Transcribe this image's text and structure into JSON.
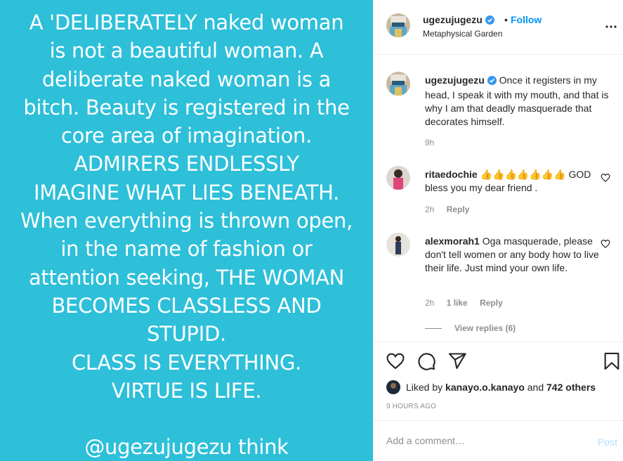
{
  "media": {
    "text": "A 'DELIBERATELY naked woman\nis not a beautiful woman. A\ndeliberate naked woman is a\nbitch. Beauty is registered in the\ncore area of imagination.\nADMIRERS ENDLESSLY\nIMAGINE WHAT LIES BENEATH.\nWhen everything is thrown open,\nin the name of fashion or\nattention seeking, THE WOMAN\nBECOMES CLASSLESS AND\nSTUPID.\nCLASS IS EVERYTHING.\nVIRTUE IS LIFE.\n\n@ugezujugezu think",
    "background_color": "#2ebfd9"
  },
  "header": {
    "username": "ugezujugezu",
    "separator": "•",
    "follow_label": "Follow",
    "location": "Metaphysical Garden",
    "more_icon": "more-horizontal-icon"
  },
  "caption": {
    "username": "ugezujugezu",
    "text": "Once it registers in my head, I speak it with my mouth, and that is why I am that deadly masquerade that decorates himself.",
    "time": "9h"
  },
  "comments": [
    {
      "username": "ritaedochie",
      "text": "👍👍👍👍👍👍👍 GOD bless you my dear friend .",
      "time": "2h",
      "likes": "",
      "reply_label": "Reply"
    },
    {
      "username": "alexmorah1",
      "text": "Oga masquerade, please don't tell women or any body how to live their life. Just mind your own life.",
      "time": "2h",
      "likes": "1 like",
      "reply_label": "Reply"
    }
  ],
  "view_replies": "View replies (6)",
  "actions": {
    "like_icon": "heart-icon",
    "comment_icon": "comment-icon",
    "share_icon": "send-icon",
    "save_icon": "bookmark-icon"
  },
  "likes": {
    "prefix": "Liked by",
    "user": "kanayo.o.kanayo",
    "middle": "and",
    "others": "742 others"
  },
  "time_ago": "9 HOURS AGO",
  "comment_input": {
    "placeholder": "Add a comment…",
    "post_label": "Post"
  },
  "colors": {
    "accent": "#0095f6",
    "post_disabled": "#b2dffc",
    "muted": "#8e8e8e"
  }
}
